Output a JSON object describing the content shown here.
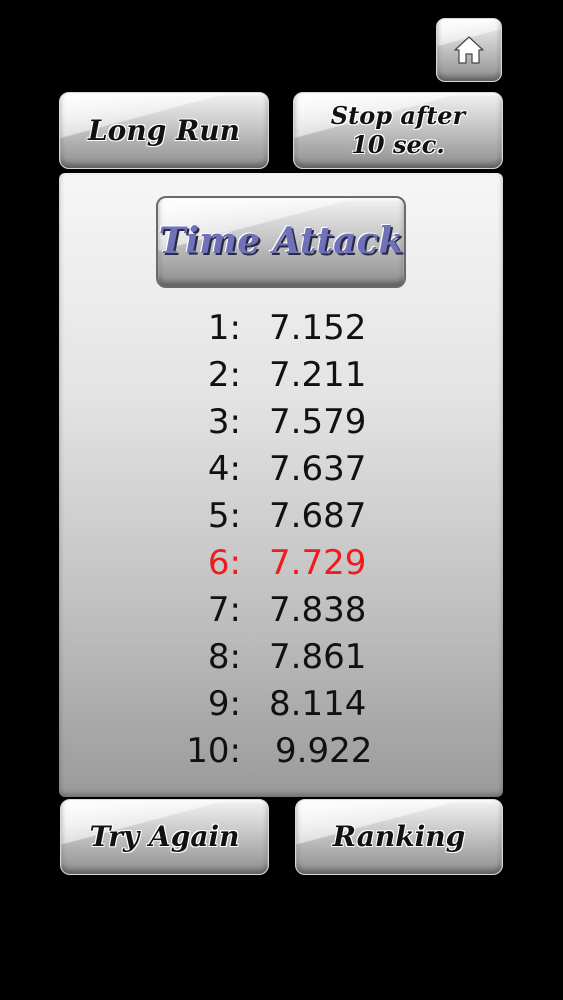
{
  "header": {
    "home_icon": "home-icon"
  },
  "modes": {
    "long_run_label": "Long Run",
    "stop_after_line1": "Stop after",
    "stop_after_line2": "10 sec."
  },
  "panel": {
    "title": "Time Attack",
    "highlight_color": "#ee1c1c",
    "title_color": "#6f72b8",
    "rankings": [
      {
        "rank": "1:",
        "time": "7.152"
      },
      {
        "rank": "2:",
        "time": "7.211"
      },
      {
        "rank": "3:",
        "time": "7.579"
      },
      {
        "rank": "4:",
        "time": "7.637"
      },
      {
        "rank": "5:",
        "time": "7.687"
      },
      {
        "rank": "6:",
        "time": "7.729",
        "highlight": true
      },
      {
        "rank": "7:",
        "time": "7.838"
      },
      {
        "rank": "8:",
        "time": "7.861"
      },
      {
        "rank": "9:",
        "time": "8.114"
      },
      {
        "rank": "10:",
        "time": "9.922"
      }
    ]
  },
  "footer": {
    "try_again_label": "Try Again",
    "ranking_label": "Ranking"
  }
}
